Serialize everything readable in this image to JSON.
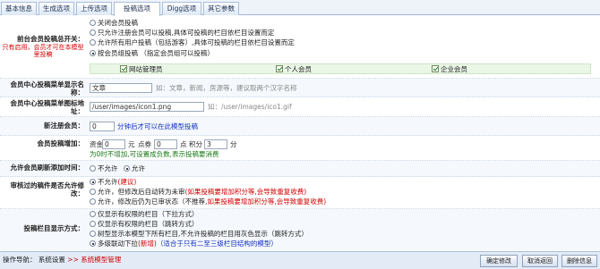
{
  "tabs": [
    "基本信息",
    "生成选项",
    "上传选项",
    "投稿选项",
    "Digg选项",
    "其它参数"
  ],
  "active_tab": "投稿选项",
  "fields": {
    "submit_switch": {
      "label": "前台会员投稿总开关：",
      "sub": "只有启用，会员才可在本模型里投稿",
      "options": [
        "关闭会员投稿",
        "只允许注册会员可以投稿,具体可投稿的栏目依栏目设置而定",
        "允许所有用户投稿（包括游客）,具体可投稿的栏目依栏目设置而定",
        "按会员组投稿 （指定会员组可以投稿）"
      ],
      "selected": 3,
      "groups": [
        "网站管理员",
        "个人会员",
        "企业会员"
      ]
    },
    "display_name": {
      "label": "会员中心投稿菜单显示名称：",
      "value": "文章",
      "hint": "如：文章，新闻，房源等，建议取两个汉字名称"
    },
    "icon": {
      "label": "会员中心投稿菜单图标地址：",
      "value": "/user/images/icon1.png",
      "hint": "如：/user/images/ico1.gif"
    },
    "new_member": {
      "label": "新注册会员：",
      "value": "0",
      "suffix": "分钟后才可以在此模型投稿"
    },
    "reward": {
      "label": "会员投稿增加：",
      "funds_label": "资金",
      "funds": "0",
      "funds_unit": "元",
      "points_label": "点券",
      "points": "0",
      "points_unit": "点",
      "score_label": "积分",
      "score": "3",
      "score_unit": "分",
      "note": "为0时不增加,可设置成负数,表示投稿要消费"
    },
    "refresh": {
      "label": "允许会员刷新添加时间：",
      "options": [
        "不允许",
        "允许"
      ],
      "selected": 1
    },
    "modify": {
      "label": "审核过的稿件是否允许修改：",
      "options": [
        {
          "text": "不允许",
          "red": "(建议)"
        },
        {
          "text": "允许，但修改后自动转为未审",
          "red": "(如果投稿要增加积分等,会导致重复收费)"
        },
        {
          "text": "允许，修改后仍为已审状态（不推荐,",
          "red": "如果投稿要增加积分等,会导致重复收费)"
        }
      ],
      "selected": 0
    },
    "column_mode": {
      "label": "投稿栏目显示方式：",
      "options": [
        {
          "text": "仅显示有权限的栏目（下拉方式）",
          "red": "",
          "blue": ""
        },
        {
          "text": "仅显示有权限的栏目（跳转方式）",
          "red": "",
          "blue": ""
        },
        {
          "text": "树型显示本模型下所有栏目,不允许投稿的栏目用灰色显示（跳转方式）",
          "red": "",
          "blue": ""
        },
        {
          "text": "多级联动下拉",
          "red": "(新增)",
          "blue": "（适合于只有二至三级栏目结构的模型）"
        }
      ],
      "selected": 3
    }
  },
  "footer": {
    "nav_label": "操作导航：",
    "nav_item1": "系统设置",
    "nav_sep": ">>",
    "nav_item2": "系统模型管理",
    "buttons": [
      "确定修改",
      "取消返回",
      "删除信息"
    ]
  }
}
